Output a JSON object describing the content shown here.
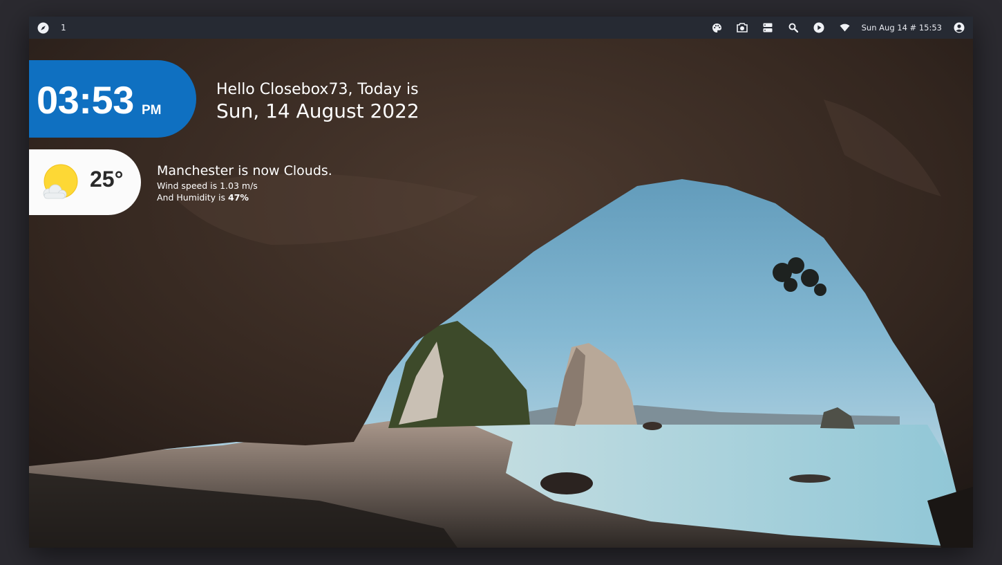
{
  "topbar": {
    "workspace": "1",
    "clock": "Sun Aug 14 # 15:53",
    "icons": [
      "compass-icon",
      "palette-icon",
      "camera-icon",
      "server-icon",
      "search-icon",
      "play-icon",
      "wifi-icon",
      "account-icon"
    ]
  },
  "clock_widget": {
    "time": "03:53",
    "ampm": "PM",
    "accent_color": "#0f70c1"
  },
  "greeting": {
    "line1": "Hello Closebox73, Today is",
    "line2": "Sun, 14 August 2022"
  },
  "weather": {
    "temperature": "25°",
    "condition_icon": "partly-cloudy-icon",
    "title": "Manchester is now Clouds.",
    "wind_prefix": "Wind speed is ",
    "wind_value": "1.03 m/s",
    "humidity_prefix": "And Humidity is ",
    "humidity_value": "47%"
  },
  "wallpaper": {
    "sky_color": "#7fb3d1",
    "rock_color": "#3a2a22",
    "sea_color": "#a9d1dc",
    "sand_color": "#b9a79a"
  }
}
